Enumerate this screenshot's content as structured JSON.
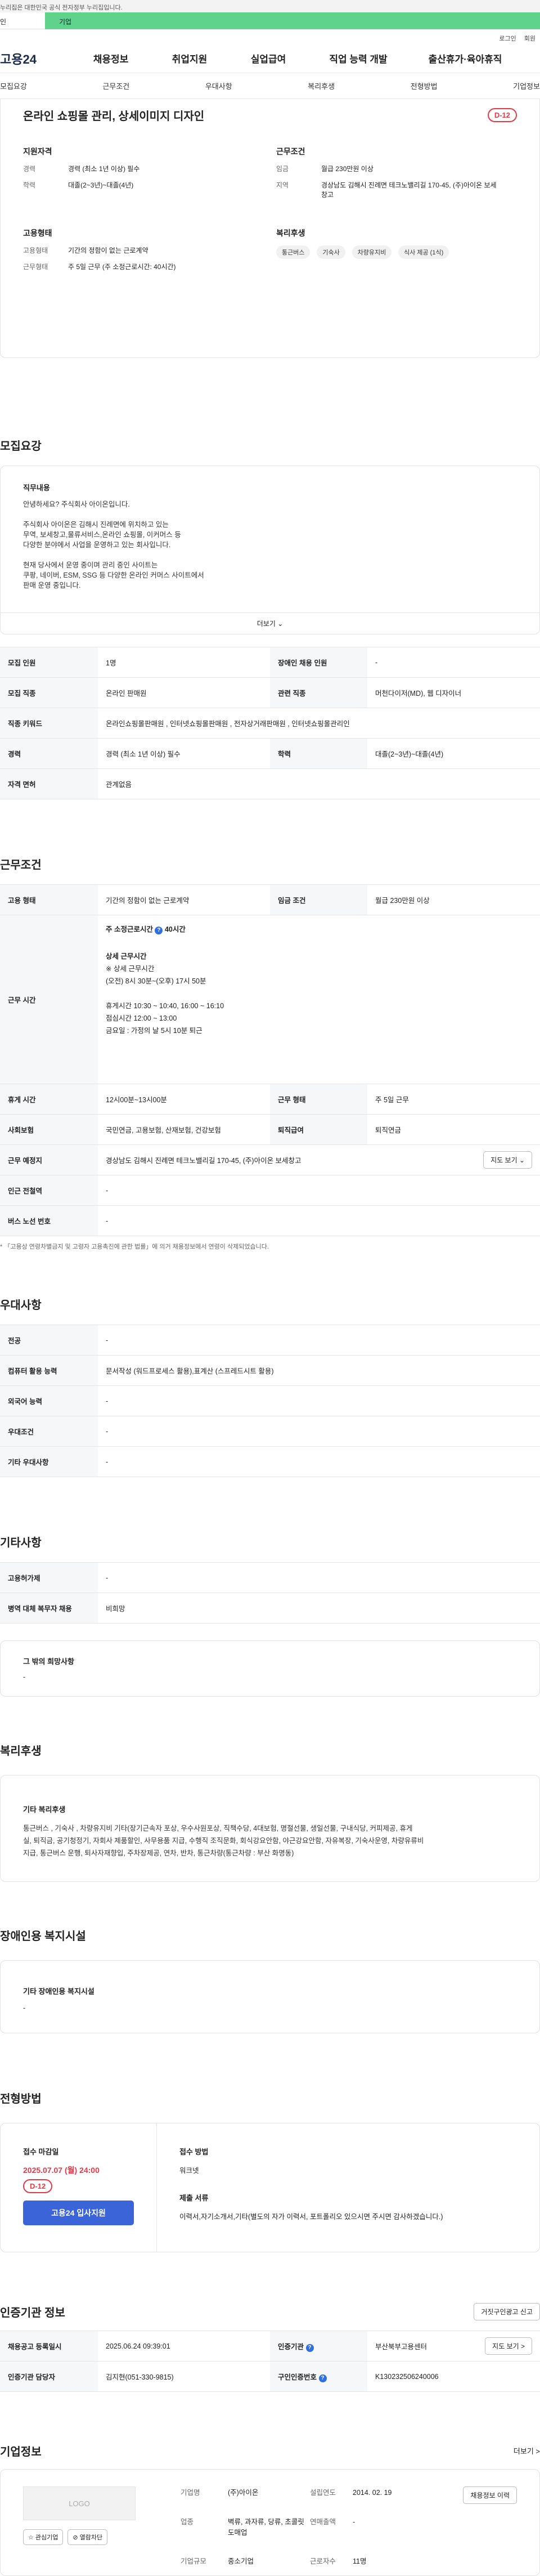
{
  "banner": {
    "text": "누리집은 대한민국 공식 전자정부 누리집입니다."
  },
  "tabs": {
    "gov": "인",
    "biz": "기업"
  },
  "util": {
    "login": "로그인",
    "signup": "회원"
  },
  "gnb": {
    "logo": "고용24",
    "menu": [
      "채용정보",
      "취업지원",
      "실업급여",
      "직업 능력 개발",
      "출산휴가·육아휴직"
    ]
  },
  "subnav": [
    "모집요강",
    "근무조건",
    "우대사항",
    "복리후생",
    "전형방법",
    "기업정보"
  ],
  "summary": {
    "title": "온라인 쇼핑몰 관리, 상세이미지 디자인",
    "dday": "D-12",
    "qual_title": "지원자격",
    "qual": [
      {
        "k": "경력",
        "v": "경력 (최소 1년 이상) 필수"
      },
      {
        "k": "학력",
        "v": "대졸(2~3년)~대졸(4년)"
      }
    ],
    "cond_title": "근무조건",
    "cond": [
      {
        "k": "임금",
        "v": "월급 230만원 이상"
      },
      {
        "k": "지역",
        "v": "경상남도 김해시 진례면 테크노밸리길 170-45, (주)아이온 보세창고"
      }
    ],
    "emp_title": "고용형태",
    "emp": [
      {
        "k": "고용형태",
        "v": "기간의 정함이 없는 근로계약"
      },
      {
        "k": "근무형태",
        "v": "주 5일 근무 (주 소정근로시간: 40시간)"
      }
    ],
    "welfare_title": "복리후생",
    "welfare": [
      "통근버스",
      "기숙사",
      "차량유지비",
      "식사 제공 (1식)"
    ]
  },
  "recruit": {
    "title": "모집요강",
    "job_label": "직무내용",
    "job_lines": [
      "안녕하세요? 주식회사 아이온입니다.",
      "",
      "주식회사 아이온은 김해시 진례면에 위치하고 있는",
      "무역, 보세창고,물류서비스,온라인 쇼핑몰, 이커머스 등",
      "다양한 분야에서 사업을 운영하고 있는 회사입니다.",
      "",
      "현재 당사에서 운영 중이며 관리 중인 사이트는",
      "쿠팡, 네이버, ESM, SSG 등 다양한 온라인 커머스 사이트에서",
      "판매 운영 중입니다."
    ],
    "more": "더보기 ⌄",
    "rows": [
      {
        "k1": "모집 인원",
        "v1": "1명",
        "k2": "장애인 채용 인원",
        "v2": "-"
      },
      {
        "k1": "모집 직종",
        "v1": "온라인 판매원",
        "k2": "관련 직종",
        "v2": "머천다이저(MD), 웹 디자이너"
      },
      {
        "k1": "직종 키워드",
        "v1": "온라인쇼핑몰판매원 , 인터넷쇼핑몰판매원 , 전자상거래판매원 , 인터넷쇼핑몰관리인",
        "k2": "",
        "v2": ""
      },
      {
        "k1": "경력",
        "v1": "경력 (최소 1년 이상) 필수",
        "k2": "학력",
        "v2": "대졸(2~3년)~대졸(4년)"
      },
      {
        "k1": "자격 면허",
        "v1": "관계없음",
        "k2": "",
        "v2": ""
      }
    ]
  },
  "work": {
    "title": "근무조건",
    "row1": {
      "k1": "고용 형태",
      "v1": "기간의 정함이 없는 근로계약",
      "k2": "임금 조건",
      "v2": "월급 230만원 이상"
    },
    "hours_label": "근무 시간",
    "hours_head": "주 소정근로시간",
    "hours_value": "40시간",
    "hours_sub": "상세 근무시간",
    "hours_lines": [
      "※ 상세 근무시간",
      "(오전) 8시 30분~(오후) 17시 50분",
      "",
      "휴게시간 10:30 ~ 10:40, 16:00 ~ 16:10",
      "점심시간 12:00 ~ 13:00",
      "금요일 : 가정의 날 5시 10분 퇴근"
    ],
    "rows": [
      {
        "k1": "휴게 시간",
        "v1": "12시00분~13시00분",
        "k2": "근무 형태",
        "v2": "주 5일 근무"
      },
      {
        "k1": "사회보험",
        "v1": "국민연금, 고용보험, 산재보험, 건강보험",
        "k2": "퇴직급여",
        "v2": "퇴직연금"
      }
    ],
    "place_label": "근무 예정지",
    "place_value": "경상남도 김해시 진례면 테크노밸리길 170-45, (주)아이온 보세창고",
    "map_btn": "지도 보기 ⌄",
    "rows2": [
      {
        "k": "인근 전철역",
        "v": "-"
      },
      {
        "k": "버스 노선 번호",
        "v": "-"
      }
    ],
    "note": "* 「고용상 연령차별금지 및 고령자 고용촉진에 관한 법률」에 의거 채용정보에서 연령이 삭제되었습니다."
  },
  "pref": {
    "title": "우대사항",
    "rows": [
      {
        "k": "전공",
        "v": "-"
      },
      {
        "k": "컴퓨터 활용 능력",
        "v": "문서작성 (워드프로세스 활용),표계산 (스프레드시트 활용)"
      },
      {
        "k": "외국어 능력",
        "v": "-"
      },
      {
        "k": "우대조건",
        "v": "-"
      },
      {
        "k": "기타 우대사항",
        "v": "-"
      }
    ]
  },
  "etc": {
    "title": "기타사항",
    "rows": [
      {
        "k": "고용허가제",
        "v": "-"
      },
      {
        "k": "병역 대체 복무자 채용",
        "v": "비희망"
      }
    ],
    "wish_label": "그 밖의 희망사항",
    "wish_value": "-"
  },
  "benefit": {
    "title": "복리후생",
    "label": "기타 복리후생",
    "lines": [
      "통근버스 , 기숙사 , 차량유지비 기타(장기근속자 포상, 우수사원포상, 직책수당, 4대보험, 명절선물, 생일선물, 구내식당, 커피제공, 휴게",
      "실, 퇴직금, 공기청정기, 자회사 제품할인, 사무용품 지급, 수행직 조직문화, 회식강요안함, 야근강요안함, 자유복장, 기숙사운영, 차량유류비",
      "지급, 통근버스 운행, 퇴사자재향입, 주차장제공, 연차, 반차, 통근차량(통근차량 : 부산 화명동)"
    ]
  },
  "disabled": {
    "title": "장애인용 복지시설",
    "label": "기타 장애인용 복지시설",
    "value": "-"
  },
  "screening": {
    "title": "전형방법",
    "deadline_label": "접수 마감일",
    "deadline": "2025.07.07 (월) 24:00",
    "dday": "D-12",
    "apply_btn": "고용24 입사지원",
    "method_label": "접수 방법",
    "method": "워크넷",
    "docs_label": "제출 서류",
    "docs": "이력서,자기소개서,기타(별도의 자가 이력서,  포트폴리오 있으시면 주시면 감사하겠습니다.)"
  },
  "cert": {
    "title": "인증기관 정보",
    "report_btn": "거짓구인광고 신고",
    "row1": {
      "k1": "채용공고 등록일시",
      "v1": "2025.06.24 09:39:01",
      "k2": "인증기관",
      "v2": "부산북부고용센터",
      "btn": "지도 보기 >"
    },
    "row2": {
      "k1": "인증기관 담당자",
      "v1": "김지현(051-330-9815)",
      "k2": "구인인증번호",
      "v2": "K130232506240006"
    }
  },
  "company": {
    "title": "기업정보",
    "more": "더보기 >",
    "logo": "LOGO",
    "fav_btn": "☆ 관심기업",
    "block_btn": "⊘ 열람차단",
    "fields": [
      {
        "k": "기업명",
        "v": "(주)아이온"
      },
      {
        "k": "설립연도",
        "v": "2014. 02. 19"
      },
      {
        "k": "업종",
        "v": "벽류, 과자류, 당류, 초콜릿 도매업"
      },
      {
        "k": "연매출액",
        "v": "-"
      },
      {
        "k": "근로자수",
        "v": "11명"
      },
      {
        "k": "기업규모",
        "v": "중소기업"
      }
    ],
    "history_btn": "채용정보 이력"
  },
  "colors": {
    "accent_green": "#5fd38c",
    "danger": "#e53946",
    "primary_blue": "#3a64d8"
  }
}
